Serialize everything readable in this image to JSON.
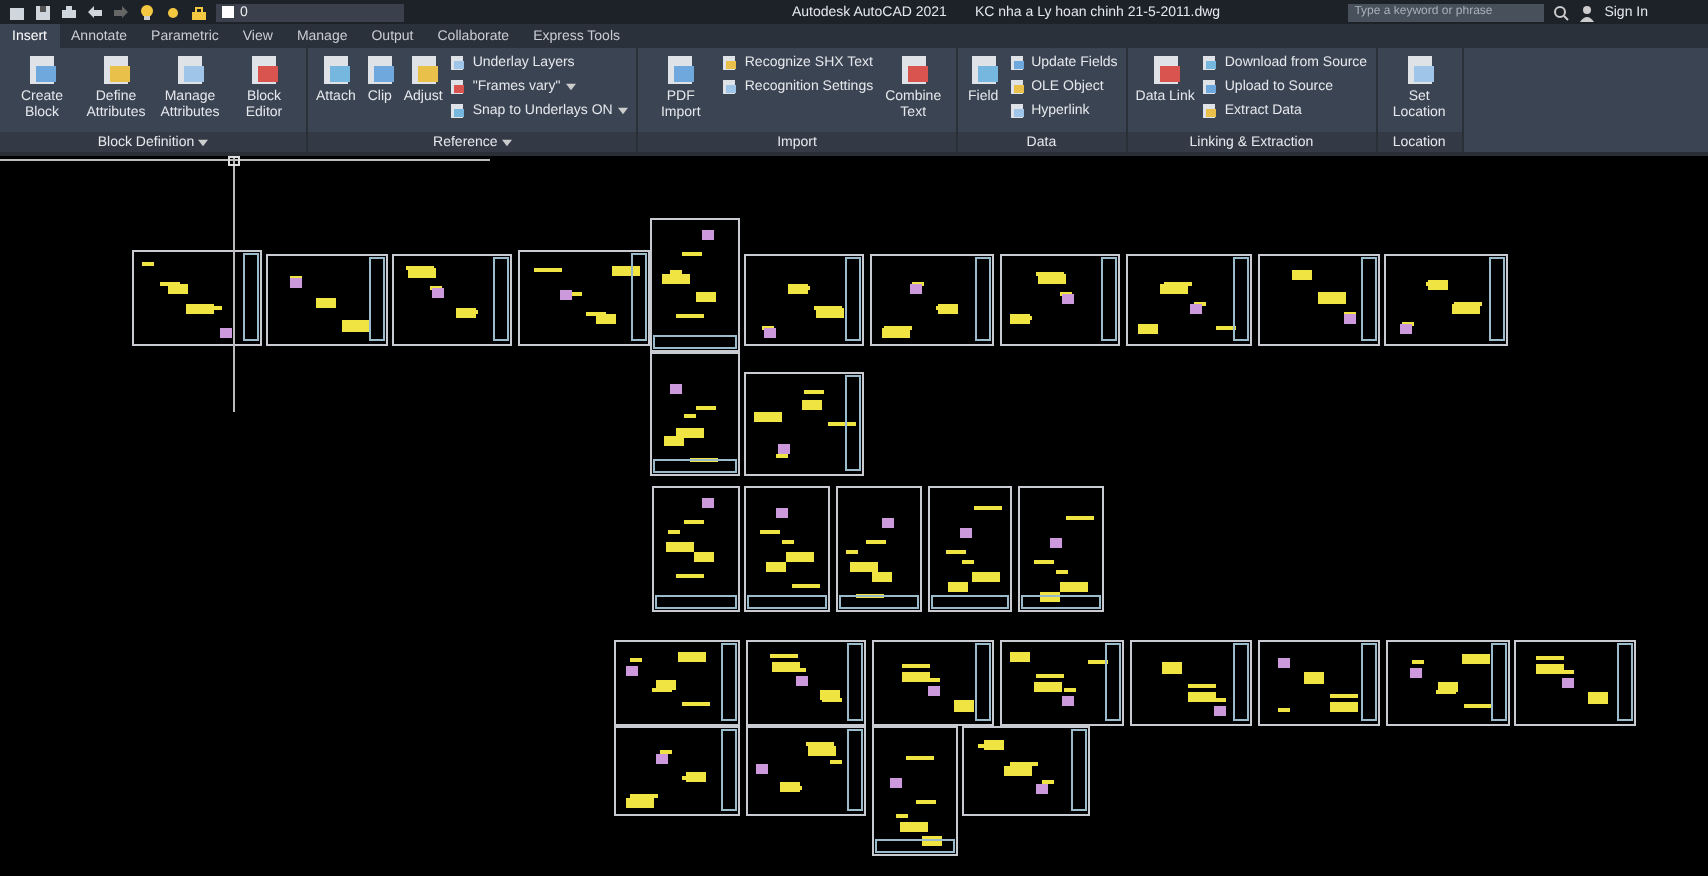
{
  "title_bar": {
    "layer_dropdown": {
      "value": "0"
    },
    "title": "Autodesk AutoCAD 2021",
    "file_name": "KC nha a Ly hoan chinh 21-5-2011.dwg",
    "search": {
      "placeholder": "Type a keyword or phrase"
    },
    "sign_in": "Sign In"
  },
  "tabs": [
    {
      "label": "Insert",
      "selected": true
    },
    {
      "label": "Annotate",
      "selected": false
    },
    {
      "label": "Parametric",
      "selected": false
    },
    {
      "label": "View",
      "selected": false
    },
    {
      "label": "Manage",
      "selected": false
    },
    {
      "label": "Output",
      "selected": false
    },
    {
      "label": "Collaborate",
      "selected": false
    },
    {
      "label": "Express Tools",
      "selected": false
    }
  ],
  "ribbon": {
    "panels": [
      {
        "title": "Block Definition",
        "has_menu": true,
        "groups": [
          {
            "kind": "large",
            "label": "Create Block"
          },
          {
            "kind": "large",
            "label": "Define Attributes"
          },
          {
            "kind": "large",
            "label": "Manage Attributes"
          },
          {
            "kind": "large",
            "label": "Block Editor"
          }
        ]
      },
      {
        "title": "Reference",
        "has_menu": true,
        "groups": [
          {
            "kind": "large",
            "label": "Attach"
          },
          {
            "kind": "large",
            "label": "Clip"
          },
          {
            "kind": "large",
            "label": "Adjust"
          },
          {
            "kind": "stack",
            "items": [
              {
                "label": "Underlay Layers",
                "dropdown": false
              },
              {
                "label": "\"Frames vary\"",
                "dropdown": true
              },
              {
                "label": "Snap to Underlays ON",
                "dropdown": true
              }
            ]
          }
        ]
      },
      {
        "title": "Import",
        "has_menu": false,
        "groups": [
          {
            "kind": "large",
            "label": "PDF Import"
          },
          {
            "kind": "stack",
            "items": [
              {
                "label": "Recognize SHX Text",
                "dropdown": false
              },
              {
                "label": "Recognition Settings",
                "dropdown": false
              }
            ]
          },
          {
            "kind": "large",
            "label": "Combine Text"
          }
        ]
      },
      {
        "title": "Data",
        "has_menu": false,
        "groups": [
          {
            "kind": "large",
            "label": "Field"
          },
          {
            "kind": "stack",
            "items": [
              {
                "label": "Update Fields",
                "dropdown": false
              },
              {
                "label": "OLE Object",
                "dropdown": false
              },
              {
                "label": "Hyperlink",
                "dropdown": false
              }
            ]
          }
        ]
      },
      {
        "title": "Linking & Extraction",
        "has_menu": false,
        "groups": [
          {
            "kind": "large",
            "label": "Data Link"
          },
          {
            "kind": "stack",
            "items": [
              {
                "label": "Download from Source",
                "dropdown": false
              },
              {
                "label": "Upload to Source",
                "dropdown": false
              },
              {
                "label": "Extract  Data",
                "dropdown": false
              }
            ]
          }
        ]
      },
      {
        "title": "Location",
        "has_menu": false,
        "groups": [
          {
            "kind": "large",
            "label": "Set Location"
          }
        ]
      }
    ]
  }
}
